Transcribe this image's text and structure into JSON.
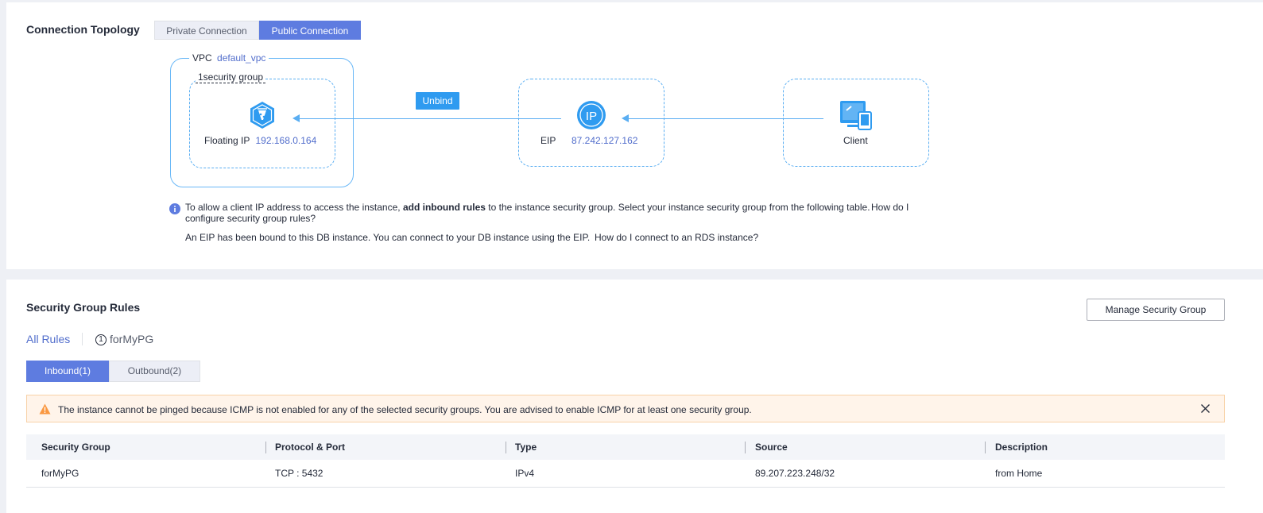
{
  "topology": {
    "title": "Connection Topology",
    "tabs": [
      {
        "label": "Private Connection",
        "active": false
      },
      {
        "label": "Public Connection",
        "active": true
      }
    ],
    "vpc_label": "VPC",
    "vpc_name": "default_vpc",
    "security_group_label": "1security group",
    "floating_ip_label": "Floating IP",
    "floating_ip_value": "192.168.0.164",
    "unbind_label": "Unbind",
    "eip_label": "EIP",
    "eip_value": "87.242.127.162",
    "eip_icon_text": "IP",
    "client_label": "Client",
    "info_prefix": "To allow a client IP address to access the instance, ",
    "info_bold": "add inbound rules",
    "info_suffix": " to the instance security group. Select your instance security group from the following table.",
    "info_link_line1": "How do I",
    "info_link_line2": "configure security group rules?",
    "eip_bound_text": "An EIP has been bound to this DB instance. You can connect to your DB instance using the EIP.",
    "eip_bound_link": "How do I connect to an RDS instance?"
  },
  "rules": {
    "title": "Security Group Rules",
    "manage_button": "Manage Security Group",
    "filters": {
      "all_rules": "All Rules",
      "group_count": "1",
      "group_name": "forMyPG"
    },
    "direction_tabs": [
      {
        "label": "Inbound(1)",
        "active": true
      },
      {
        "label": "Outbound(2)",
        "active": false
      }
    ],
    "alert_text": "The instance cannot be pinged because ICMP is not enabled for any of the selected security groups. You are advised to enable ICMP for at least one security group.",
    "columns": [
      "Security Group",
      "Protocol & Port",
      "Type",
      "Source",
      "Description"
    ],
    "rows": [
      {
        "security_group": "forMyPG",
        "protocol_port": "TCP : 5432",
        "type": "IPv4",
        "source": "89.207.223.248/32",
        "description": "from Home"
      }
    ]
  },
  "colors": {
    "accent": "#5e7ce0",
    "topology_blue": "#2f9bf0",
    "link": "#526ecc",
    "warning": "#fa9841"
  },
  "icons": [
    "floating-ip-icon",
    "eip-icon",
    "client-icon",
    "info-icon",
    "warning-icon",
    "close-icon"
  ]
}
